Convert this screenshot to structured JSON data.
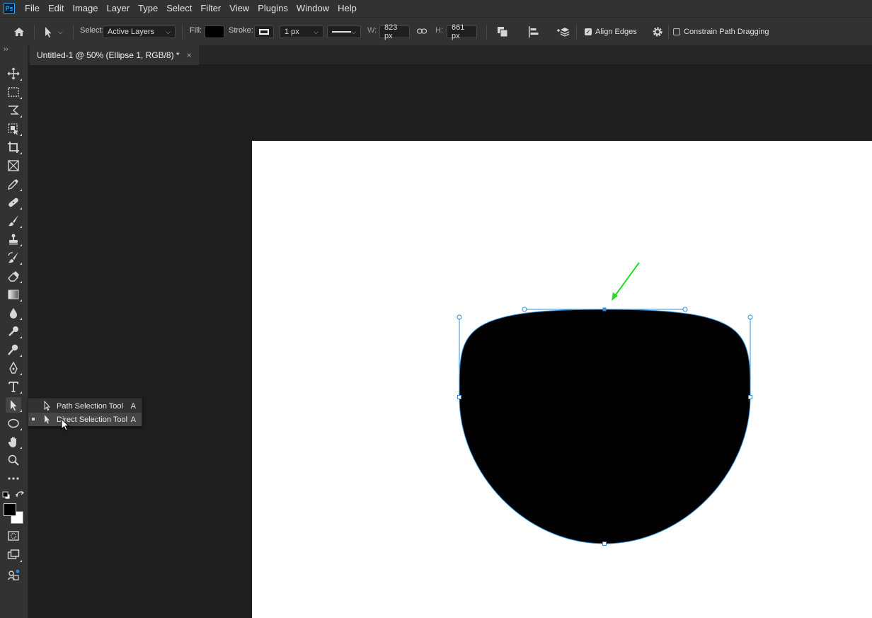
{
  "app": {
    "logo_text": "Ps"
  },
  "menu": [
    "File",
    "Edit",
    "Image",
    "Layer",
    "Type",
    "Select",
    "Filter",
    "View",
    "Plugins",
    "Window",
    "Help"
  ],
  "options": {
    "select_label": "Select:",
    "select_value": "Active Layers",
    "fill_label": "Fill:",
    "stroke_label": "Stroke:",
    "stroke_width": "1 px",
    "w_label": "W:",
    "w_value": "823 px",
    "h_label": "H:",
    "h_value": "661 px",
    "align_edges_label": "Align Edges",
    "align_edges_checked": true,
    "constrain_label": "Constrain Path Dragging",
    "constrain_checked": false
  },
  "document": {
    "tab_title": "Untitled-1 @ 50% (Ellipse 1, RGB/8) *",
    "close": "×"
  },
  "flyout": {
    "items": [
      {
        "label": "Path Selection Tool",
        "shortcut": "A"
      },
      {
        "label": "Direct Selection Tool",
        "shortcut": "A"
      }
    ]
  },
  "colors": {
    "foreground": "#000000",
    "background": "#ffffff",
    "path": "#2f8fd8",
    "arrow": "#22dd22",
    "shape_fill": "#000000"
  }
}
